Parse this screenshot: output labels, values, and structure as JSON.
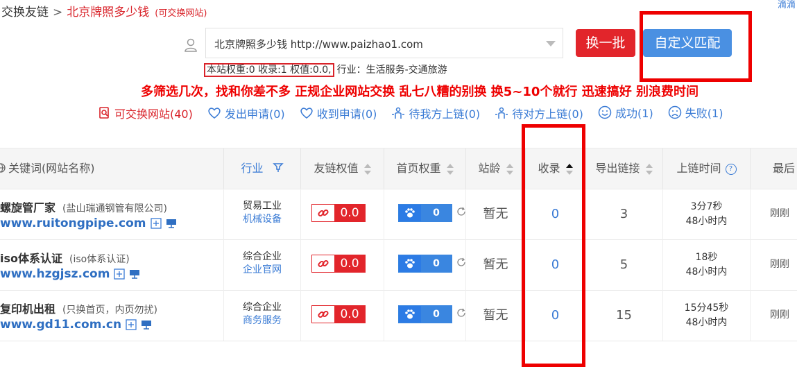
{
  "breadcrumb": {
    "root": "交换友链",
    "sep": ">",
    "current": "北京牌照多少钱",
    "note": "(可交换网站)"
  },
  "topright": "滴滴",
  "site_select": {
    "value": "北京牌照多少钱 http://www.paizhao1.com"
  },
  "buttons": {
    "swap": "换一批",
    "custom": "自定义匹配"
  },
  "stats": {
    "boxed": "本站权重:0 收录:1 权值:0.0,",
    "industry": "行业：生活服务-交通旅游"
  },
  "slogan": "多筛选几次，找和你差不多 正规企业网站交换 乱七八糟的别换 换5~10个就行 迅速搞好 别浪费时间",
  "filters": [
    {
      "label": "可交换网站(40)",
      "icon": "search-doc-icon"
    },
    {
      "label": "发出申请(0)",
      "icon": "heart-send-icon"
    },
    {
      "label": "收到申请(0)",
      "icon": "heart-receive-icon"
    },
    {
      "label": "待我方上链(0)",
      "icon": "person-link-icon"
    },
    {
      "label": "待对方上链(0)",
      "icon": "person-wait-icon"
    },
    {
      "label": "成功(1)",
      "icon": "smile-icon"
    },
    {
      "label": "失败(1)",
      "icon": "frown-icon"
    }
  ],
  "table": {
    "headers": {
      "keyword": "关键词(网站名称)",
      "industry": "行业",
      "link_weight": "友链权值",
      "home_weight": "首页权重",
      "age": "站龄",
      "indexed": "收录",
      "outlinks": "导出链接",
      "link_time": "上链时间",
      "last": "最后"
    },
    "rows": [
      {
        "name": "螺旋管厂家",
        "sub": "(盐山瑞通钢管有限公司)",
        "url": "www.ruitongpipe.com",
        "ind1": "贸易工业",
        "ind2": "机械设备",
        "link_weight": "0.0",
        "home_weight": "0",
        "age": "暂无",
        "indexed": "0",
        "outlinks": "3",
        "time1": "3分7秒",
        "time2": "48小时内",
        "last": "刚刚"
      },
      {
        "name": "iso体系认证",
        "sub": "(iso体系认证)",
        "url": "www.hzgjsz.com",
        "ind1": "综合企业",
        "ind2": "企业官网",
        "link_weight": "0.0",
        "home_weight": "0",
        "age": "暂无",
        "indexed": "0",
        "outlinks": "5",
        "time1": "18秒",
        "time2": "48小时内",
        "last": "刚刚"
      },
      {
        "name": "复印机出租",
        "sub": "(只换首页，内页勿扰)",
        "url": "www.gd11.com.cn",
        "ind1": "综合企业",
        "ind2": "商务服务",
        "link_weight": "0.0",
        "home_weight": "0",
        "age": "暂无",
        "indexed": "0",
        "outlinks": "15",
        "time1": "15分45秒",
        "time2": "48小时内",
        "last": "刚刚"
      }
    ]
  },
  "colors": {
    "red": "#e2252b",
    "blue": "#4a90e2",
    "link_blue": "#3a7bd5",
    "annotation_red": "#ee0000"
  }
}
